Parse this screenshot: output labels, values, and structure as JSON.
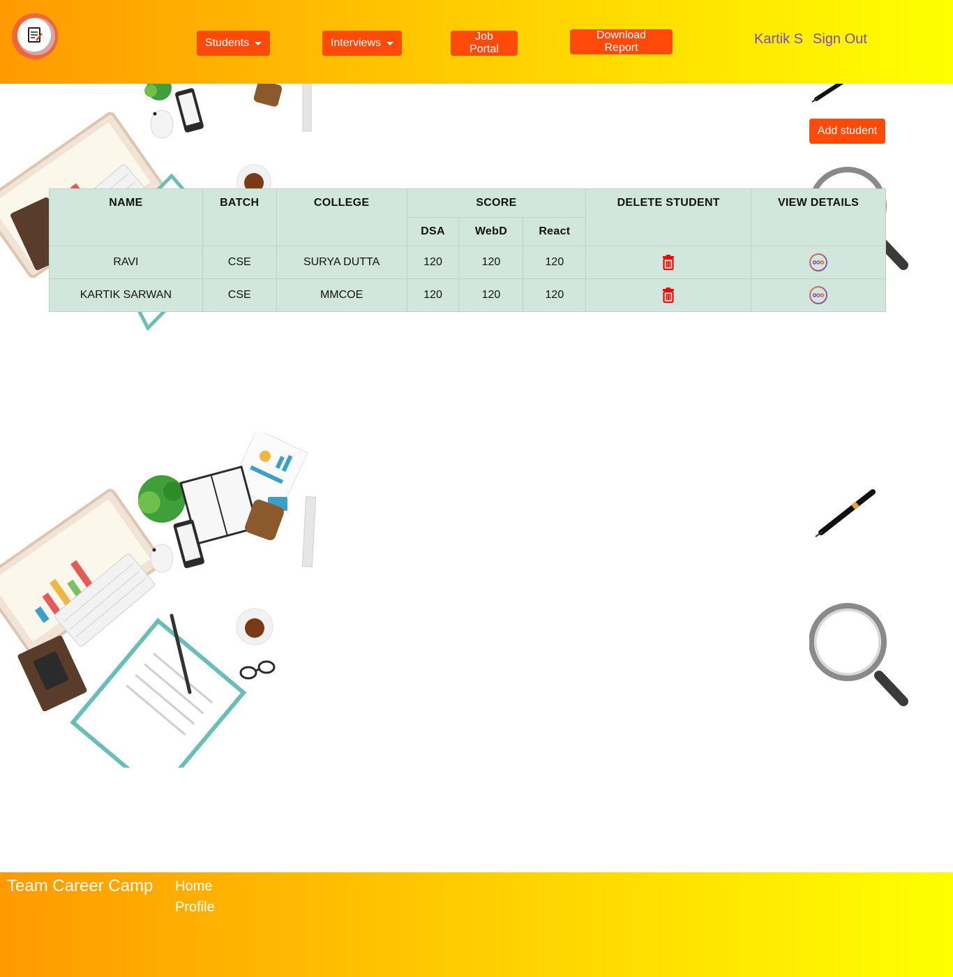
{
  "header": {
    "nav": {
      "students": "Students",
      "interviews": "Interviews",
      "job_portal": "Job Portal",
      "download_report": "Download Report"
    },
    "user_name": "Kartik S",
    "sign_out": "Sign Out"
  },
  "actions": {
    "add_student": "Add student"
  },
  "table": {
    "headers": {
      "name": "NAME",
      "batch": "BATCH",
      "college": "COLLEGE",
      "score": "SCORE",
      "dsa": "DSA",
      "webd": "WebD",
      "react": "React",
      "delete": "DELETE STUDENT",
      "details": "VIEW DETAILS"
    },
    "rows": [
      {
        "name": "RAVI",
        "batch": "CSE",
        "college": "SURYA DUTTA",
        "dsa": "120",
        "webd": "120",
        "react": "120"
      },
      {
        "name": "KARTIK SARWAN",
        "batch": "CSE",
        "college": "MMCOE",
        "dsa": "120",
        "webd": "120",
        "react": "120"
      }
    ]
  },
  "footer": {
    "title": "Team Career Camp",
    "links": {
      "home": "Home",
      "profile": "Profile"
    }
  },
  "icons": {
    "logo": "resume-logo-icon",
    "delete": "trash-icon",
    "details": "more-options-icon"
  },
  "colors": {
    "header_gradient_start": "#ff9a00",
    "header_gradient_end": "#ffff00",
    "button": "#ff4a0a",
    "user_link": "#7d4bbd",
    "table_bg": "#d1e7dd",
    "delete_icon": "#ff0000"
  }
}
